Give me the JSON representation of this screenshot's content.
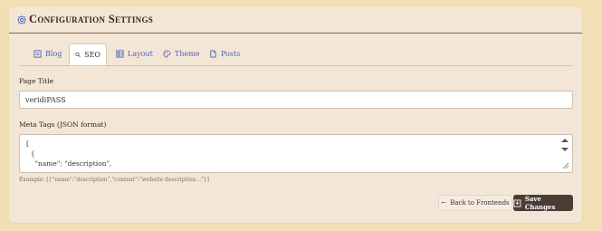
{
  "header": {
    "title": "Configuration Settings",
    "icon": "gear-icon"
  },
  "tabs": [
    {
      "label": "Blog",
      "icon": "document-icon"
    },
    {
      "label": "SEO",
      "icon": "search-icon",
      "active": true
    },
    {
      "label": "Layout",
      "icon": "grid-icon"
    },
    {
      "label": "Theme",
      "icon": "palette-icon"
    },
    {
      "label": "Posts",
      "icon": "file-icon"
    }
  ],
  "form": {
    "page_title_label": "Page Title",
    "page_title_value": "veridiPASS",
    "meta_tags_label": "Meta Tags (JSON format)",
    "meta_tags_lines": [
      "[",
      "  {",
      "    \"name\": \"description\","
    ],
    "meta_tags_hint": "Example: [{\"name\":\"description\",\"content\":\"website description...\"}]"
  },
  "actions": {
    "back_label": "Back to Frontends",
    "save_label": "Save Changes"
  },
  "colors": {
    "page_bg": "#f2dfb6",
    "panel_bg": "#f4e6d6",
    "tab_link": "#4a63b8",
    "save_button_bg": "#4a3d36"
  }
}
